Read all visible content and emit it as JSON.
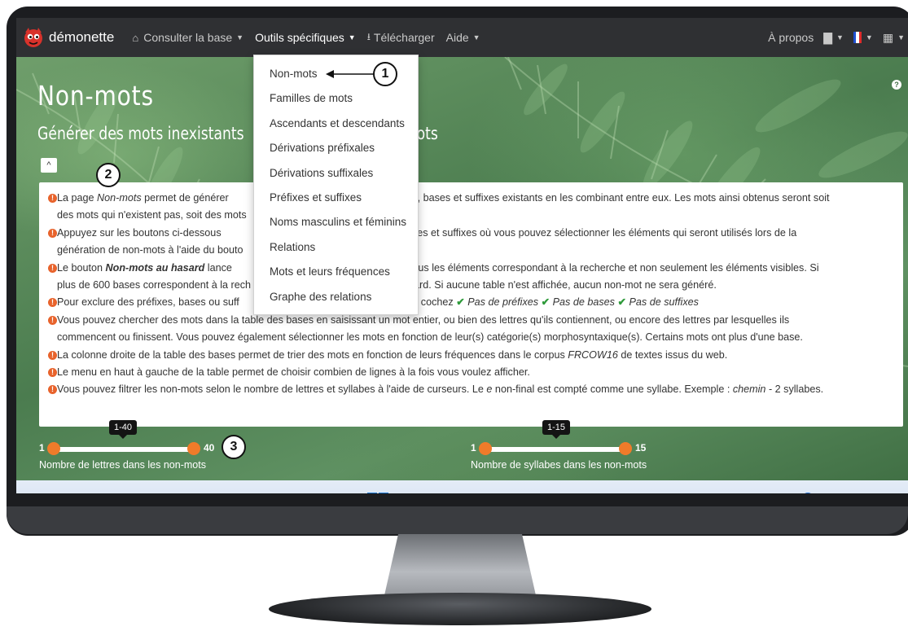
{
  "navbar": {
    "brand": "démonette",
    "items": [
      {
        "label": "Consulter la base",
        "icon": "home-icon"
      },
      {
        "label": "Outils spécifiques"
      },
      {
        "label": "Télécharger",
        "icon": "download-icon"
      },
      {
        "label": "Aide"
      }
    ],
    "right": {
      "about": "À propos",
      "icons": [
        "comment-icon",
        "french-flag-icon",
        "id-card-icon"
      ]
    }
  },
  "dropdown": {
    "items": [
      "Non-mots",
      "Familles de mots",
      "Ascendants et descendants",
      "Dérivations préfixales",
      "Dérivations suffixales",
      "Préfixes et suffixes",
      "Noms masculins et féminins",
      "Relations",
      "Mots et leurs fréquences",
      "Graphe des relations"
    ]
  },
  "page": {
    "title": "Non-mots",
    "subtitle_left": "Générer des mots inexistants",
    "subtitle_right": "mots",
    "collapse": "^"
  },
  "info": {
    "lines": [
      {
        "prefix": "La page ",
        "em": "Non-mots",
        "text": " permet de générer",
        "right": "fixes, bases et suffixes existants en les combinant entre eux. Les mots ainsi obtenus seront soit"
      },
      {
        "text": "des mots qui n'existent pas, soit des mots"
      },
      {
        "text": "Appuyez sur les boutons ci-dessous",
        "right": "es, bases et suffixes où vous pouvez sélectionner les éléments qui seront utilisés lors de la"
      },
      {
        "text": "génération de non-mots à l'aide du bouto"
      },
      {
        "prefix": "Le bouton ",
        "strong": "Non-mots au hasard",
        "text": " lance",
        "right": "ir de tous les éléments correspondant à la recherche et non seulement les éléments visibles. Si"
      },
      {
        "text": "plus de 600 bases correspondent à la rech",
        "right": "ard. Si aucune table n'est affichée, aucun non-mot ne sera généré."
      },
      {
        "text": "Pour exclure des préfixes, bases ou suff",
        "right": ", cochez",
        "checks": [
          "Pas de préfixes",
          "Pas de bases",
          "Pas de suffixes"
        ]
      },
      {
        "text": "Vous pouvez chercher des mots dans la table des bases en saisissant un mot entier, ou bien des lettres qu'ils contiennent, ou encore des lettres par lesquelles ils"
      },
      {
        "text": "commencent ou finissent. Vous pouvez également sélectionner les mots en fonction de leur(s) catégorie(s) morphosyntaxique(s). Certains mots ont plus d'une base."
      },
      {
        "prefix": "La colonne droite de la table des bases permet de trier des mots en fonction de leurs fréquences dans le corpus ",
        "em": "FRCOW16",
        "text": " de textes issus du web."
      },
      {
        "text": "Le menu en haut à gauche de la table permet de choisir combien de lignes à la fois vous voulez afficher."
      },
      {
        "prefix": "Vous pouvez filtrer les non-mots selon le nombre de lettres et syllabes à l'aide de curseurs. Le ",
        "em": "e",
        "text": " non-final est compté comme une syllabe. Exemple : ",
        "em2": "chemin",
        "tail": " - 2 syllabes."
      }
    ]
  },
  "sliders": {
    "letters": {
      "min": "1",
      "max": "40",
      "tooltip": "1-40",
      "label": "Nombre de lettres dans les non-mots"
    },
    "syllables": {
      "min": "1",
      "max": "15",
      "tooltip": "1-15",
      "label": "Nombre de syllabes dans les non-mots"
    }
  },
  "taskbar": {
    "icons": [
      "windows-start-icon",
      "search-icon",
      "task-view-icon",
      "widgets-icon",
      "teams-chat-icon",
      "file-explorer-icon",
      "firefox-icon",
      "store-icon"
    ]
  },
  "callouts": [
    "1",
    "2",
    "3"
  ],
  "colors": {
    "navbar": "#2f3033",
    "accent_orange": "#f07b2a",
    "warn": "#e8632c",
    "check_green": "#2e9a3a"
  }
}
